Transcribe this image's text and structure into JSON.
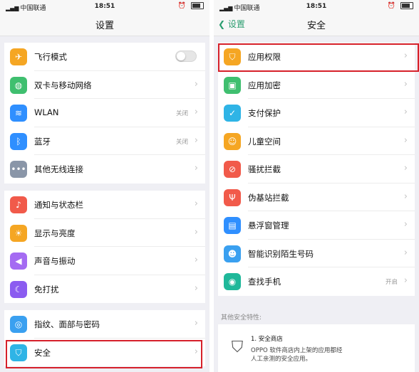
{
  "status_bar": {
    "carrier": "中国联通",
    "time": "18:51"
  },
  "left_screen": {
    "title": "设置",
    "groups": [
      [
        {
          "label": "飞行模式",
          "icon": "airplane-icon",
          "color": "#f5a623",
          "control": "toggle",
          "toggle_on": false
        },
        {
          "label": "双卡与移动网络",
          "icon": "globe-icon",
          "color": "#3fbf6f",
          "control": "chevron"
        },
        {
          "label": "WLAN",
          "icon": "wifi-icon",
          "color": "#2f8fff",
          "value": "关闭",
          "control": "chevron"
        },
        {
          "label": "蓝牙",
          "icon": "bluetooth-icon",
          "color": "#2f8fff",
          "value": "关闭",
          "control": "chevron"
        },
        {
          "label": "其他无线连接",
          "icon": "more-icon",
          "color": "#8a96a8",
          "control": "chevron"
        }
      ],
      [
        {
          "label": "通知与状态栏",
          "icon": "bell-icon",
          "color": "#f15a4a",
          "control": "chevron"
        },
        {
          "label": "显示与亮度",
          "icon": "sun-icon",
          "color": "#f5a623",
          "control": "chevron"
        },
        {
          "label": "声音与振动",
          "icon": "speaker-icon",
          "color": "#a46bf2",
          "control": "chevron"
        },
        {
          "label": "免打扰",
          "icon": "moon-icon",
          "color": "#8b5cf0",
          "control": "chevron"
        }
      ],
      [
        {
          "label": "指纹、面部与密码",
          "icon": "fingerprint-icon",
          "color": "#3aa0f0",
          "control": "chevron"
        },
        {
          "label": "安全",
          "icon": "shield-icon",
          "color": "#2fb4e6",
          "control": "chevron"
        }
      ]
    ]
  },
  "right_screen": {
    "back_label": "设置",
    "title": "安全",
    "items": [
      {
        "label": "应用权限",
        "icon": "shield-key-icon",
        "color": "#f5a623"
      },
      {
        "label": "应用加密",
        "icon": "lock-icon",
        "color": "#3fbf6f"
      },
      {
        "label": "支付保护",
        "icon": "shield-check-icon",
        "color": "#2fb4e6"
      },
      {
        "label": "儿童空间",
        "icon": "child-icon",
        "color": "#f5a623"
      },
      {
        "label": "骚扰拦截",
        "icon": "block-icon",
        "color": "#f15a4a"
      },
      {
        "label": "伪基站拦截",
        "icon": "tower-icon",
        "color": "#f15a4a"
      },
      {
        "label": "悬浮窗管理",
        "icon": "window-icon",
        "color": "#2f8fff"
      },
      {
        "label": "智能识别陌生号码",
        "icon": "contact-icon",
        "color": "#3aa0f0"
      },
      {
        "label": "查找手机",
        "icon": "locate-icon",
        "color": "#1fb89a",
        "value": "开启"
      }
    ],
    "other_caption": "其他安全特性:",
    "store": {
      "title": "1. 安全商店",
      "line1": "OPPO 软件商店内上架的应用都经",
      "line2": "人工亲测的安全应用。"
    }
  },
  "colors": {
    "highlight": "#d6202a",
    "accent_green": "#2a9d6f"
  }
}
